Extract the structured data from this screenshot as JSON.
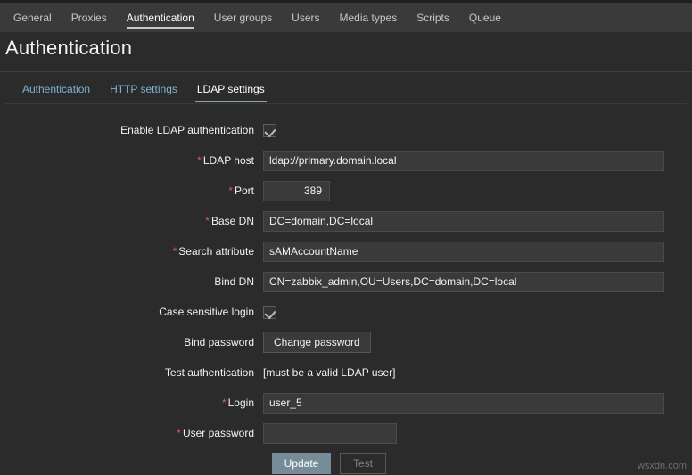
{
  "nav": {
    "items": [
      {
        "label": "General",
        "active": false
      },
      {
        "label": "Proxies",
        "active": false
      },
      {
        "label": "Authentication",
        "active": true
      },
      {
        "label": "User groups",
        "active": false
      },
      {
        "label": "Users",
        "active": false
      },
      {
        "label": "Media types",
        "active": false
      },
      {
        "label": "Scripts",
        "active": false
      },
      {
        "label": "Queue",
        "active": false
      }
    ]
  },
  "page": {
    "title": "Authentication"
  },
  "subtabs": [
    {
      "label": "Authentication",
      "active": false
    },
    {
      "label": "HTTP settings",
      "active": false
    },
    {
      "label": "LDAP settings",
      "active": true
    }
  ],
  "form": {
    "enable_ldap_label": "Enable LDAP authentication",
    "enable_ldap_checked": true,
    "ldap_host_label": "LDAP host",
    "ldap_host_value": "ldap://primary.domain.local",
    "port_label": "Port",
    "port_value": "389",
    "base_dn_label": "Base DN",
    "base_dn_value": "DC=domain,DC=local",
    "search_attribute_label": "Search attribute",
    "search_attribute_value": "sAMAccountName",
    "bind_dn_label": "Bind DN",
    "bind_dn_value": "CN=zabbix_admin,OU=Users,DC=domain,DC=local",
    "case_sensitive_label": "Case sensitive login",
    "case_sensitive_checked": true,
    "bind_password_label": "Bind password",
    "change_password_button": "Change password",
    "test_authentication_label": "Test authentication",
    "test_authentication_hint": "[must be a valid LDAP user]",
    "login_label": "Login",
    "login_value": "user_5",
    "user_password_label": "User password",
    "user_password_value": "",
    "required_marker": "*"
  },
  "actions": {
    "update_label": "Update",
    "test_label": "Test"
  },
  "watermark": "wsxdn.com",
  "colors": {
    "accent_link": "#7fb2d4",
    "required": "#d45c5c",
    "primary_button": "#768d99",
    "navbar": "#3a3a3a",
    "page_background": "#2b2b2b"
  }
}
